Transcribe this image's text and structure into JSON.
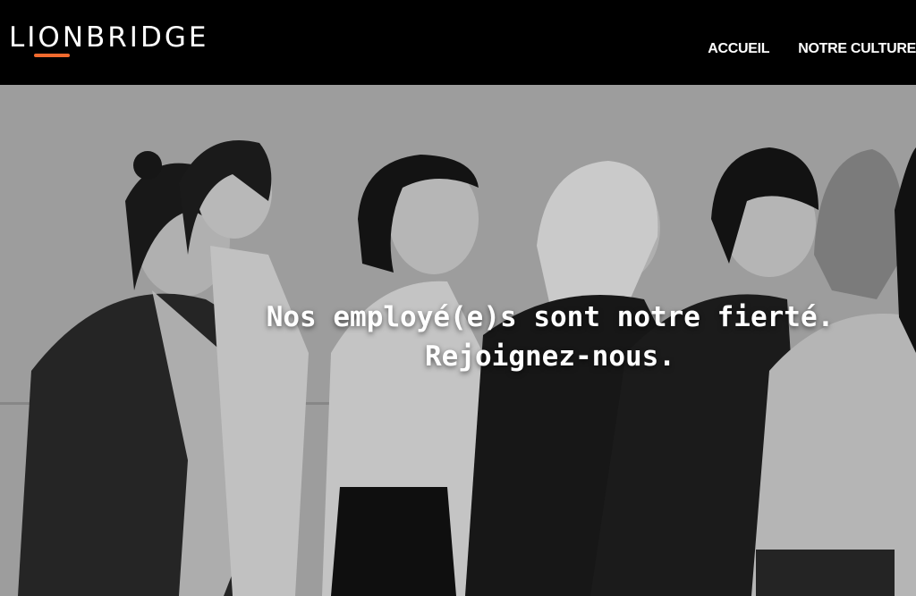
{
  "header": {
    "logo_text": "LIONBRIDGE",
    "logo_accent_color": "#f26a2e",
    "nav": [
      {
        "label": "ACCUEIL"
      },
      {
        "label": "NOTRE CULTURE"
      }
    ]
  },
  "hero": {
    "headline_line1": "Nos employé(e)s sont notre fierté.",
    "headline_line2": "Rejoignez-nous.",
    "image_icon": "group-photo-image"
  }
}
